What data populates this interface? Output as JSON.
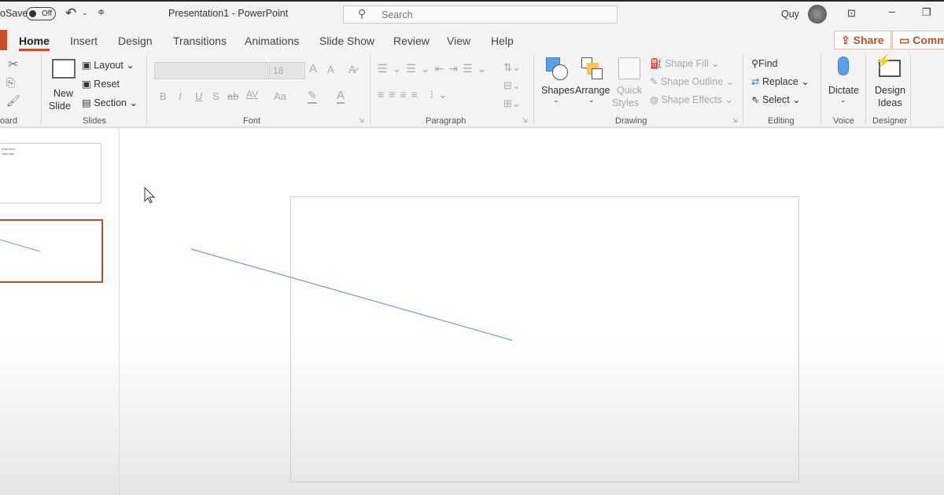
{
  "titlebar": {
    "autosave_label": "oSave",
    "autosave_state": "Off",
    "title": "Presentation1  -  PowerPoint",
    "search_placeholder": "Search",
    "user": "Quy"
  },
  "tabs": [
    "Home",
    "Insert",
    "Design",
    "Transitions",
    "Animations",
    "Slide Show",
    "Review",
    "View",
    "Help"
  ],
  "actions": {
    "share": "Share",
    "comments": "Comm"
  },
  "ribbon": {
    "clipboard": {
      "label": "oard"
    },
    "slides": {
      "label": "Slides",
      "new_slide_1": "New",
      "new_slide_2": "Slide",
      "layout": "Layout",
      "reset": "Reset",
      "section": "Section"
    },
    "font": {
      "label": "Font",
      "size": "18",
      "bold": "B",
      "italic": "I",
      "underline": "U",
      "shadow": "S",
      "strike": "ab",
      "spacing": "AV",
      "case": "Aa",
      "grow": "A",
      "shrink": "A"
    },
    "paragraph": {
      "label": "Paragraph"
    },
    "drawing": {
      "label": "Drawing",
      "shapes": "Shapes",
      "arrange": "Arrange",
      "quick_1": "Quick",
      "quick_2": "Styles",
      "shape_fill": "Shape Fill",
      "shape_outline": "Shape Outline",
      "shape_effects": "Shape Effects"
    },
    "editing": {
      "label": "Editing",
      "find": "Find",
      "replace": "Replace",
      "select": "Select"
    },
    "voice": {
      "label": "Voice",
      "dictate": "Dictate"
    },
    "designer": {
      "label": "Designer",
      "design_1": "Design",
      "design_2": "Ideas"
    }
  },
  "thumbnails": {
    "slide1_lines": [
      "Khối hình",
      "Hình ảnh"
    ]
  },
  "colors": {
    "accent": "#c4502a",
    "line": "#7f95c9"
  }
}
